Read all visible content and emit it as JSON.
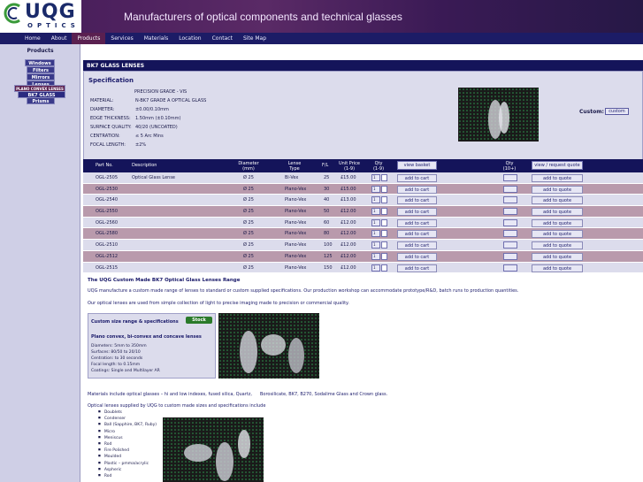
{
  "header": {
    "logo_text": "UQG",
    "logo_sub": "OPTICS",
    "tagline": "Manufacturers of optical components and technical glasses"
  },
  "nav": {
    "items": [
      "Home",
      "About",
      "Products",
      "Services",
      "Materials",
      "Location",
      "Contact",
      "Site Map"
    ],
    "active": "Products"
  },
  "sidebar": {
    "title": "Products",
    "items": [
      "Windows",
      "Filters",
      "Mirrors",
      "Lenses",
      "PLANO CONVEX LENSES",
      "BK7 GLASS LENSES",
      "Prisms"
    ]
  },
  "section": {
    "title": "BK7 GLASS LENSES"
  },
  "spec": {
    "title": "Specification",
    "grade": "PRECISION GRADE - VIS",
    "rows": [
      {
        "k": "MATERIAL:",
        "v": "N-BK7 GRADE A OPTICAL GLASS"
      },
      {
        "k": "DIAMETER:",
        "v": "±0.00/0.10mm"
      },
      {
        "k": "EDGE THICKNESS:",
        "v": "1.50mm (±0.10mm)"
      },
      {
        "k": "SURFACE QUALITY:",
        "v": "40/20 (UNCOATED)"
      },
      {
        "k": "CENTRATION:",
        "v": "≤ 5 Arc Mins"
      },
      {
        "k": "FOCAL LENGTH:",
        "v": "±2%"
      }
    ],
    "custom_label": "Custom:",
    "custom_button": "custom"
  },
  "table": {
    "headers": {
      "part": "Part No.",
      "desc": "Description",
      "diam": "Diameter\n(mm)",
      "type": "Lense\nType",
      "fl": "F/L",
      "price": "Unit Price\n(1-9)",
      "qty": "Qty\n(1-9)",
      "view_basket": "view basket",
      "qty2": "Qty\n(10+)",
      "view_quote": "view / request quote"
    },
    "rows": [
      {
        "part": "OGL-2505",
        "desc": "Optical Glass Lense",
        "diam": "Ø 25",
        "type": "Bi-Vex",
        "fl": "25",
        "price": "£15.00",
        "qty": "1",
        "cart": "add to cart",
        "quote": "add to quote"
      },
      {
        "part": "OGL-2530",
        "desc": "",
        "diam": "Ø 25",
        "type": "Plano-Vex",
        "fl": "30",
        "price": "£15.00",
        "qty": "1",
        "cart": "add to cart",
        "quote": "add to quote"
      },
      {
        "part": "OGL-2540",
        "desc": "",
        "diam": "Ø 25",
        "type": "Plano-Vex",
        "fl": "40",
        "price": "£13.00",
        "qty": "1",
        "cart": "add to cart",
        "quote": "add to quote"
      },
      {
        "part": "OGL-2550",
        "desc": "",
        "diam": "Ø 25",
        "type": "Plano-Vex",
        "fl": "50",
        "price": "£12.00",
        "qty": "1",
        "cart": "add to cart",
        "quote": "add to quote"
      },
      {
        "part": "OGL-2560",
        "desc": "",
        "diam": "Ø 25",
        "type": "Plano-Vex",
        "fl": "60",
        "price": "£12.00",
        "qty": "1",
        "cart": "add to cart",
        "quote": "add to quote"
      },
      {
        "part": "OGL-2580",
        "desc": "",
        "diam": "Ø 25",
        "type": "Plano-Vex",
        "fl": "80",
        "price": "£12.00",
        "qty": "1",
        "cart": "add to cart",
        "quote": "add to quote"
      },
      {
        "part": "OGL-2510",
        "desc": "",
        "diam": "Ø 25",
        "type": "Plano-Vex",
        "fl": "100",
        "price": "£12.00",
        "qty": "1",
        "cart": "add to cart",
        "quote": "add to quote"
      },
      {
        "part": "OGL-2512",
        "desc": "",
        "diam": "Ø 25",
        "type": "Plano-Vex",
        "fl": "125",
        "price": "£12.00",
        "qty": "1",
        "cart": "add to cart",
        "quote": "add to quote"
      },
      {
        "part": "OGL-2515",
        "desc": "",
        "diam": "Ø 25",
        "type": "Plano-Vex",
        "fl": "150",
        "price": "£12.00",
        "qty": "1",
        "cart": "add to cart",
        "quote": "add to quote"
      }
    ]
  },
  "lower": {
    "title": "The UQG Custom Made BK7 Optical Glass Lenses Range",
    "para1": "UQG manufacture a custom made range of lenses to standard or custom supplied specifications. Our production workshop can accommodate prototype/R&D, batch runs to production quantities.",
    "para2": "Our optical lenses are used from simple collection of light to precise imaging made to precision or commercial quality.",
    "promo": {
      "title": "Custom size range & specifications",
      "stock_button": "Stock",
      "subtitle": "Plano convex, bi-convex and concave lenses",
      "lines": [
        "Diameters: 5mm to 350mm",
        "Surfaces: 80/50 to 20/10",
        "Centration: to 30 seconds",
        "Focal length: to 0.15mm",
        "Coatings: Single and Multilayer AR"
      ]
    },
    "materials_a": "Materials include optical glasses – hi and low indexes, fused silica, Quartz,",
    "materials_b": "Borosilicate, BK7, B270, Sodalime Glass and Crown glass.",
    "supplied": "Optical lenses supplied by UQG to custom made sizes and specifications include",
    "list": [
      "Doublets",
      "Condenser",
      "Ball (Sapphire, BK7, Ruby)",
      "Micro",
      "Meniscus",
      "Rod",
      "Fire Polished",
      "Moulded",
      "Plastic – pmma/acrylic",
      "Aspheric",
      "Rod"
    ]
  }
}
